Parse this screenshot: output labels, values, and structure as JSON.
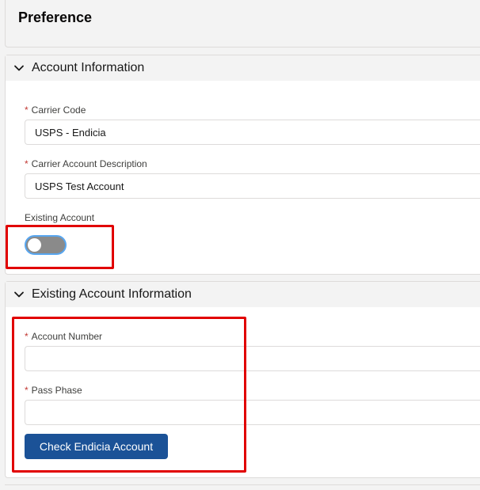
{
  "page": {
    "title": "Preference"
  },
  "account_info": {
    "section_title": "Account Information",
    "carrier_code": {
      "label": "Carrier Code",
      "required_mark": "*",
      "value": "USPS - Endicia"
    },
    "carrier_account_description": {
      "label": "Carrier Account Description",
      "required_mark": "*",
      "value": "USPS Test Account"
    },
    "existing_account": {
      "label": "Existing Account",
      "checked": false
    }
  },
  "existing_account_info": {
    "section_title": "Existing Account Information",
    "account_number": {
      "label": "Account Number",
      "required_mark": "*",
      "value": ""
    },
    "pass_phase": {
      "label": "Pass Phase",
      "required_mark": "*",
      "value": ""
    },
    "check_button_label": "Check Endicia Account"
  },
  "colors": {
    "accent": "#1b5297",
    "highlight": "#e10000",
    "required": "#c23934",
    "toggle_off": "#8a8a8a"
  },
  "icons": {
    "section_toggle": "chevron-down-icon"
  }
}
